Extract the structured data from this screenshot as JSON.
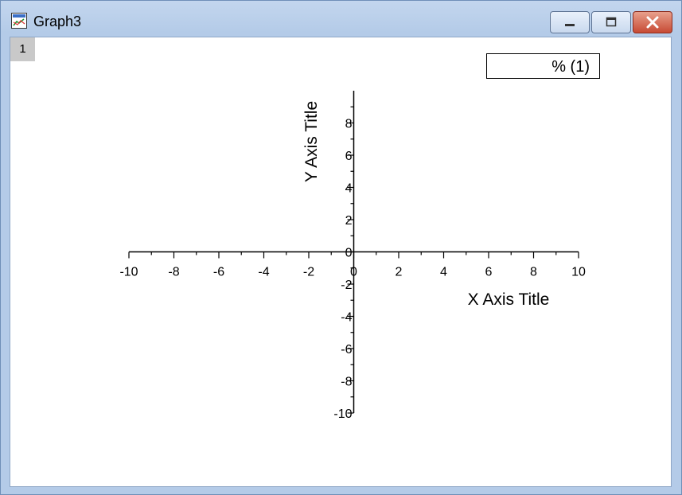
{
  "window": {
    "title": "Graph3",
    "icon": "graph-window-icon",
    "controls": [
      "minimize-icon",
      "maximize-icon",
      "close-icon"
    ]
  },
  "layer_tab": "1",
  "legend": {
    "text": "% (1)"
  },
  "chart_data": {
    "type": "line",
    "series": [],
    "xlabel": "X Axis Title",
    "ylabel": "Y Axis Title",
    "xlim": [
      -10,
      10
    ],
    "ylim": [
      -10,
      10
    ],
    "x_ticks": [
      "-10",
      "-8",
      "-6",
      "-4",
      "-2",
      "0",
      "2",
      "4",
      "6",
      "8",
      "10"
    ],
    "y_ticks": [
      "-10",
      "-8",
      "-6",
      "-4",
      "-2",
      "0",
      "2",
      "4",
      "6",
      "8"
    ],
    "grid": false,
    "legend_position": "top-right"
  }
}
